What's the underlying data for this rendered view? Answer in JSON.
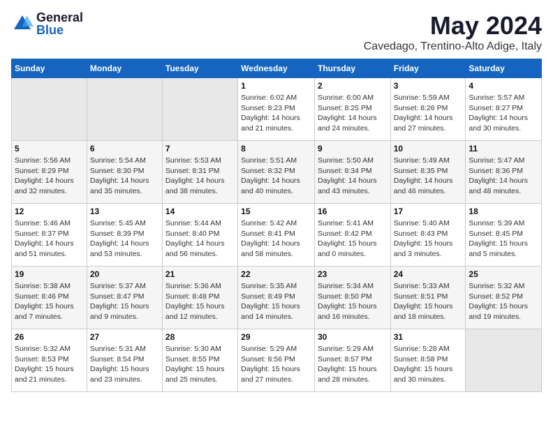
{
  "logo": {
    "general": "General",
    "blue": "Blue"
  },
  "title": "May 2024",
  "location": "Cavedago, Trentino-Alto Adige, Italy",
  "headers": [
    "Sunday",
    "Monday",
    "Tuesday",
    "Wednesday",
    "Thursday",
    "Friday",
    "Saturday"
  ],
  "weeks": [
    [
      {
        "day": "",
        "info": ""
      },
      {
        "day": "",
        "info": ""
      },
      {
        "day": "",
        "info": ""
      },
      {
        "day": "1",
        "info": "Sunrise: 6:02 AM\nSunset: 8:23 PM\nDaylight: 14 hours\nand 21 minutes."
      },
      {
        "day": "2",
        "info": "Sunrise: 6:00 AM\nSunset: 8:25 PM\nDaylight: 14 hours\nand 24 minutes."
      },
      {
        "day": "3",
        "info": "Sunrise: 5:59 AM\nSunset: 8:26 PM\nDaylight: 14 hours\nand 27 minutes."
      },
      {
        "day": "4",
        "info": "Sunrise: 5:57 AM\nSunset: 8:27 PM\nDaylight: 14 hours\nand 30 minutes."
      }
    ],
    [
      {
        "day": "5",
        "info": "Sunrise: 5:56 AM\nSunset: 8:29 PM\nDaylight: 14 hours\nand 32 minutes."
      },
      {
        "day": "6",
        "info": "Sunrise: 5:54 AM\nSunset: 8:30 PM\nDaylight: 14 hours\nand 35 minutes."
      },
      {
        "day": "7",
        "info": "Sunrise: 5:53 AM\nSunset: 8:31 PM\nDaylight: 14 hours\nand 38 minutes."
      },
      {
        "day": "8",
        "info": "Sunrise: 5:51 AM\nSunset: 8:32 PM\nDaylight: 14 hours\nand 40 minutes."
      },
      {
        "day": "9",
        "info": "Sunrise: 5:50 AM\nSunset: 8:34 PM\nDaylight: 14 hours\nand 43 minutes."
      },
      {
        "day": "10",
        "info": "Sunrise: 5:49 AM\nSunset: 8:35 PM\nDaylight: 14 hours\nand 46 minutes."
      },
      {
        "day": "11",
        "info": "Sunrise: 5:47 AM\nSunset: 8:36 PM\nDaylight: 14 hours\nand 48 minutes."
      }
    ],
    [
      {
        "day": "12",
        "info": "Sunrise: 5:46 AM\nSunset: 8:37 PM\nDaylight: 14 hours\nand 51 minutes."
      },
      {
        "day": "13",
        "info": "Sunrise: 5:45 AM\nSunset: 8:39 PM\nDaylight: 14 hours\nand 53 minutes."
      },
      {
        "day": "14",
        "info": "Sunrise: 5:44 AM\nSunset: 8:40 PM\nDaylight: 14 hours\nand 56 minutes."
      },
      {
        "day": "15",
        "info": "Sunrise: 5:42 AM\nSunset: 8:41 PM\nDaylight: 14 hours\nand 58 minutes."
      },
      {
        "day": "16",
        "info": "Sunrise: 5:41 AM\nSunset: 8:42 PM\nDaylight: 15 hours\nand 0 minutes."
      },
      {
        "day": "17",
        "info": "Sunrise: 5:40 AM\nSunset: 8:43 PM\nDaylight: 15 hours\nand 3 minutes."
      },
      {
        "day": "18",
        "info": "Sunrise: 5:39 AM\nSunset: 8:45 PM\nDaylight: 15 hours\nand 5 minutes."
      }
    ],
    [
      {
        "day": "19",
        "info": "Sunrise: 5:38 AM\nSunset: 8:46 PM\nDaylight: 15 hours\nand 7 minutes."
      },
      {
        "day": "20",
        "info": "Sunrise: 5:37 AM\nSunset: 8:47 PM\nDaylight: 15 hours\nand 9 minutes."
      },
      {
        "day": "21",
        "info": "Sunrise: 5:36 AM\nSunset: 8:48 PM\nDaylight: 15 hours\nand 12 minutes."
      },
      {
        "day": "22",
        "info": "Sunrise: 5:35 AM\nSunset: 8:49 PM\nDaylight: 15 hours\nand 14 minutes."
      },
      {
        "day": "23",
        "info": "Sunrise: 5:34 AM\nSunset: 8:50 PM\nDaylight: 15 hours\nand 16 minutes."
      },
      {
        "day": "24",
        "info": "Sunrise: 5:33 AM\nSunset: 8:51 PM\nDaylight: 15 hours\nand 18 minutes."
      },
      {
        "day": "25",
        "info": "Sunrise: 5:32 AM\nSunset: 8:52 PM\nDaylight: 15 hours\nand 19 minutes."
      }
    ],
    [
      {
        "day": "26",
        "info": "Sunrise: 5:32 AM\nSunset: 8:53 PM\nDaylight: 15 hours\nand 21 minutes."
      },
      {
        "day": "27",
        "info": "Sunrise: 5:31 AM\nSunset: 8:54 PM\nDaylight: 15 hours\nand 23 minutes."
      },
      {
        "day": "28",
        "info": "Sunrise: 5:30 AM\nSunset: 8:55 PM\nDaylight: 15 hours\nand 25 minutes."
      },
      {
        "day": "29",
        "info": "Sunrise: 5:29 AM\nSunset: 8:56 PM\nDaylight: 15 hours\nand 27 minutes."
      },
      {
        "day": "30",
        "info": "Sunrise: 5:29 AM\nSunset: 8:57 PM\nDaylight: 15 hours\nand 28 minutes."
      },
      {
        "day": "31",
        "info": "Sunrise: 5:28 AM\nSunset: 8:58 PM\nDaylight: 15 hours\nand 30 minutes."
      },
      {
        "day": "",
        "info": ""
      }
    ]
  ]
}
